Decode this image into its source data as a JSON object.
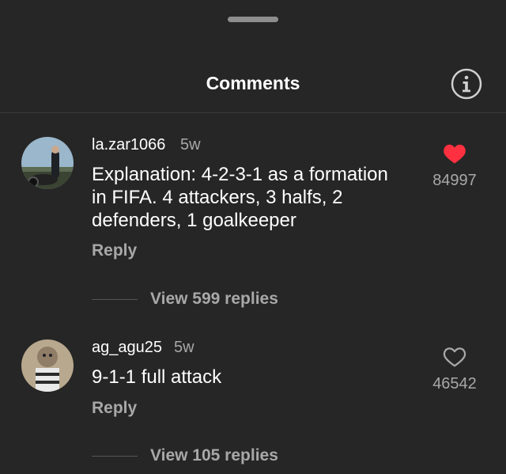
{
  "header": {
    "title": "Comments",
    "info_icon": "info-icon"
  },
  "comments": [
    {
      "username": "la.zar1066",
      "time": "5w",
      "text": "Explanation: 4-2-3-1 as a formation in FIFA. 4 attackers, 3 halfs, 2 defenders, 1 goalkeeper",
      "reply_label": "Reply",
      "likes": "84997",
      "liked": true,
      "view_replies": "View 599 replies"
    },
    {
      "username": "ag_agu25",
      "time": "5w",
      "text": "9-1-1 full attack",
      "reply_label": "Reply",
      "likes": "46542",
      "liked": false,
      "view_replies": "View 105 replies"
    }
  ],
  "colors": {
    "background": "#262626",
    "heart_liked": "#ff3040",
    "muted": "#a8a8a8"
  }
}
